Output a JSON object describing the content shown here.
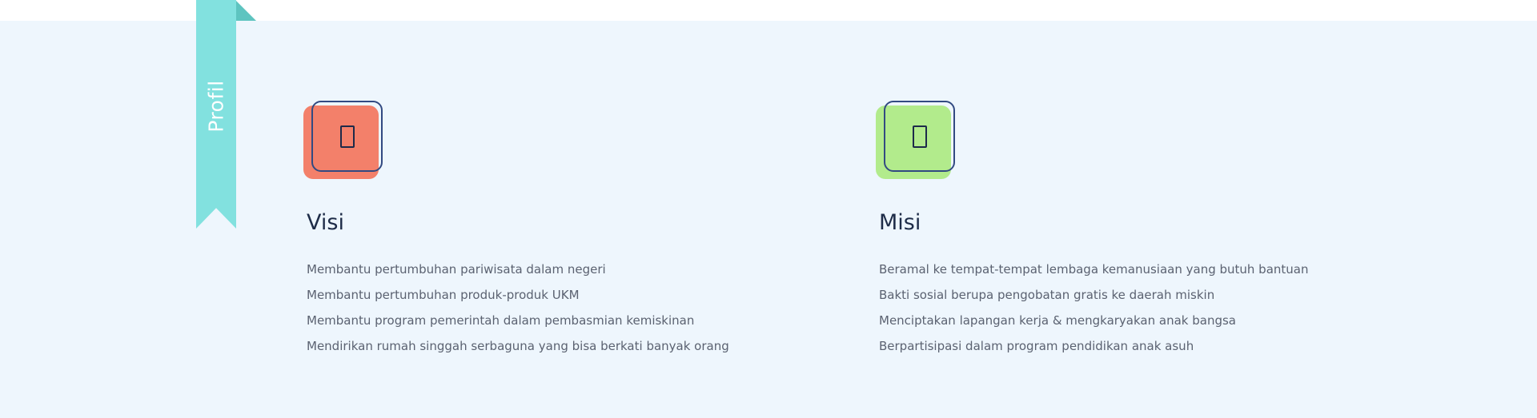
{
  "ribbon": {
    "label": "Profil",
    "color": "#82e1df"
  },
  "visi": {
    "title": "Visi",
    "icon": "document-icon",
    "icon_color": "#f3806a",
    "items": [
      "Membantu pertumbuhan pariwisata dalam negeri",
      "Membantu pertumbuhan produk-produk UKM",
      "Membantu program pemerintah dalam pembasmian kemiskinan",
      "Mendirikan rumah singgah serbaguna yang bisa berkati banyak orang"
    ]
  },
  "misi": {
    "title": "Misi",
    "icon": "document-icon",
    "icon_color": "#b2eb8c",
    "items": [
      "Beramal ke tempat-tempat lembaga kemanusiaan yang butuh bantuan",
      "Bakti sosial berupa pengobatan gratis ke daerah miskin",
      "Menciptakan lapangan kerja & mengkaryakan anak bangsa",
      "Berpartisipasi dalam program pendidikan anak asuh"
    ]
  },
  "colors": {
    "section_background": "#eef6fd",
    "icon_frame": "#324a82",
    "text": "#5b6271",
    "heading": "#1e2c48"
  }
}
